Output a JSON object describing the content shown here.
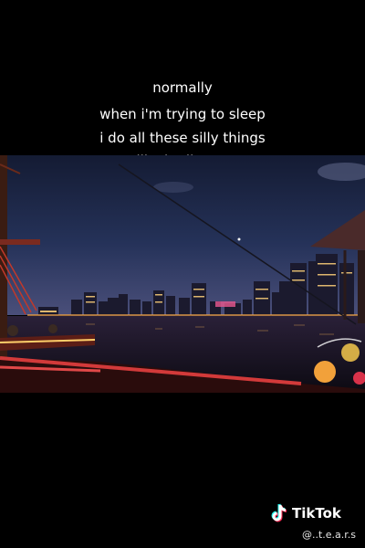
{
  "captions": [
    "normally",
    "when i'm trying to sleep",
    "i do all these silly things",
    "like i roll over"
  ],
  "watermark": {
    "brand": "TikTok",
    "handle": "@..t.e.a.r.s"
  },
  "icons": {
    "logo": "tiktok-logo-icon"
  },
  "colors": {
    "background": "#000000",
    "sky": "#1d2746",
    "water": "#1a1020",
    "railing": "#d23a3a",
    "city_lights": "#ffd27a"
  }
}
